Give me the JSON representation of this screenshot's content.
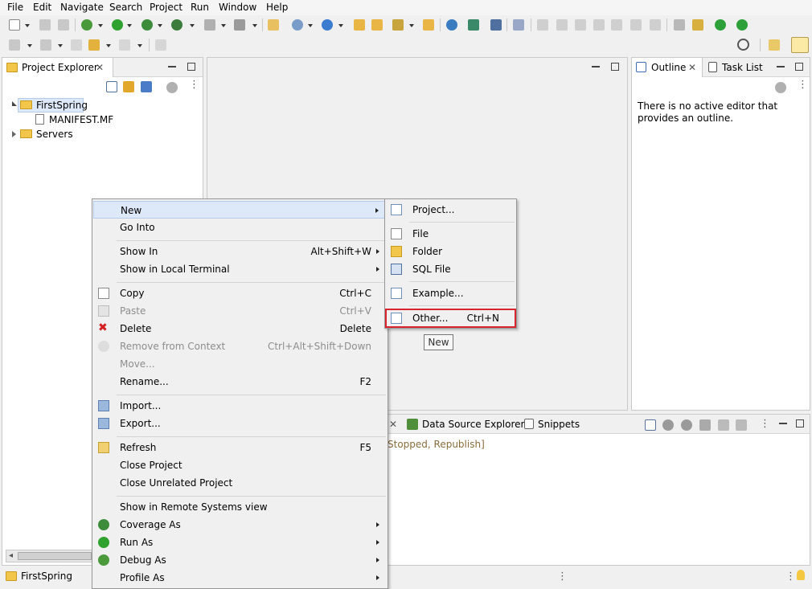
{
  "menubar": [
    "File",
    "Edit",
    "Navigate",
    "Search",
    "Project",
    "Run",
    "Window",
    "Help"
  ],
  "project_explorer": {
    "title": "Project Explorer",
    "tree": [
      {
        "label": "FirstSpring"
      },
      {
        "label": "MANIFEST.MF"
      },
      {
        "label": "Servers"
      }
    ]
  },
  "outline": {
    "tab_outline": "Outline",
    "tab_tasklist": "Task List",
    "message": "There is no active editor that provides an outline."
  },
  "bottom_panel": {
    "tab_data_source": "Data Source Explorer",
    "tab_snippets": "Snippets",
    "server_status": "Stopped, Republish]"
  },
  "status_bar": {
    "selected": "FirstSpring"
  },
  "context_menu": {
    "new": {
      "label": "New"
    },
    "go_into": {
      "label": "Go Into"
    },
    "show_in": {
      "label": "Show In",
      "shortcut": "Alt+Shift+W"
    },
    "show_local_terminal": {
      "label": "Show in Local Terminal"
    },
    "copy": {
      "label": "Copy",
      "shortcut": "Ctrl+C"
    },
    "paste": {
      "label": "Paste",
      "shortcut": "Ctrl+V"
    },
    "delete": {
      "label": "Delete",
      "shortcut": "Delete"
    },
    "remove_context": {
      "label": "Remove from Context",
      "shortcut": "Ctrl+Alt+Shift+Down"
    },
    "move": {
      "label": "Move..."
    },
    "rename": {
      "label": "Rename...",
      "shortcut": "F2"
    },
    "import": {
      "label": "Import..."
    },
    "export": {
      "label": "Export..."
    },
    "refresh": {
      "label": "Refresh",
      "shortcut": "F5"
    },
    "close_project": {
      "label": "Close Project"
    },
    "close_unrelated": {
      "label": "Close Unrelated Project"
    },
    "show_remote": {
      "label": "Show in Remote Systems view"
    },
    "coverage_as": {
      "label": "Coverage As"
    },
    "run_as": {
      "label": "Run As"
    },
    "debug_as": {
      "label": "Debug As"
    },
    "profile_as": {
      "label": "Profile As"
    }
  },
  "new_submenu": {
    "project": {
      "label": "Project..."
    },
    "file": {
      "label": "File"
    },
    "folder": {
      "label": "Folder"
    },
    "sql_file": {
      "label": "SQL File"
    },
    "example": {
      "label": "Example..."
    },
    "other": {
      "label": "Other...",
      "shortcut": "Ctrl+N"
    }
  },
  "tooltip": "New",
  "colors": {
    "highlight_border": "#d9232e",
    "selection": "#dde8f8",
    "folder": "#f2c64a"
  }
}
